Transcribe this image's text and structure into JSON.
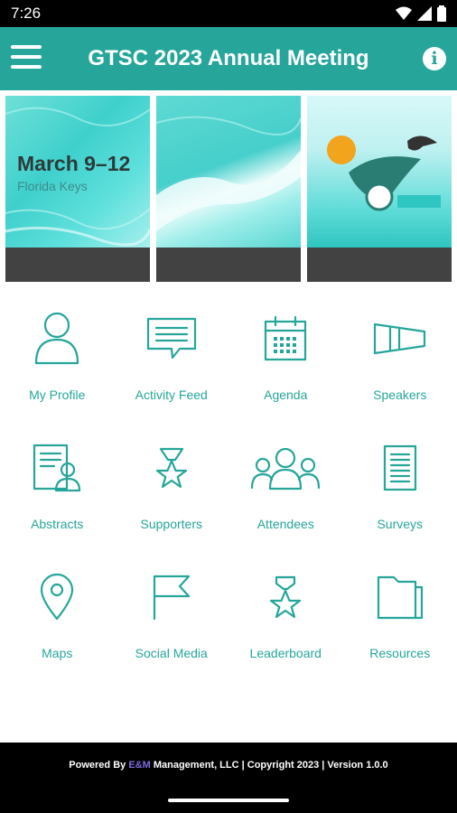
{
  "status_bar": {
    "time": "7:26"
  },
  "app_bar": {
    "title": "GTSC 2023 Annual Meeting"
  },
  "banner": {
    "tile1": {
      "date": "March 9–12",
      "location": "Florida Keys"
    }
  },
  "tiles": [
    {
      "label": "My Profile",
      "icon": "person-icon"
    },
    {
      "label": "Activity Feed",
      "icon": "chat-icon"
    },
    {
      "label": "Agenda",
      "icon": "calendar-icon"
    },
    {
      "label": "Speakers",
      "icon": "megaphone-icon"
    },
    {
      "label": "Abstracts",
      "icon": "document-person-icon"
    },
    {
      "label": "Supporters",
      "icon": "star-award-icon"
    },
    {
      "label": "Attendees",
      "icon": "group-icon"
    },
    {
      "label": "Surveys",
      "icon": "list-document-icon"
    },
    {
      "label": "Maps",
      "icon": "map-pin-icon"
    },
    {
      "label": "Social Media",
      "icon": "flag-icon"
    },
    {
      "label": "Leaderboard",
      "icon": "medal-icon"
    },
    {
      "label": "Resources",
      "icon": "folder-icon"
    }
  ],
  "footer": {
    "prefix": "Powered By ",
    "brand": "E&M",
    "suffix": " Management, LLC | Copyright 2023 | Version 1.0.0"
  },
  "colors": {
    "accent": "#26a69a",
    "banner_bar": "#424242",
    "brand": "#7e6cdb"
  }
}
